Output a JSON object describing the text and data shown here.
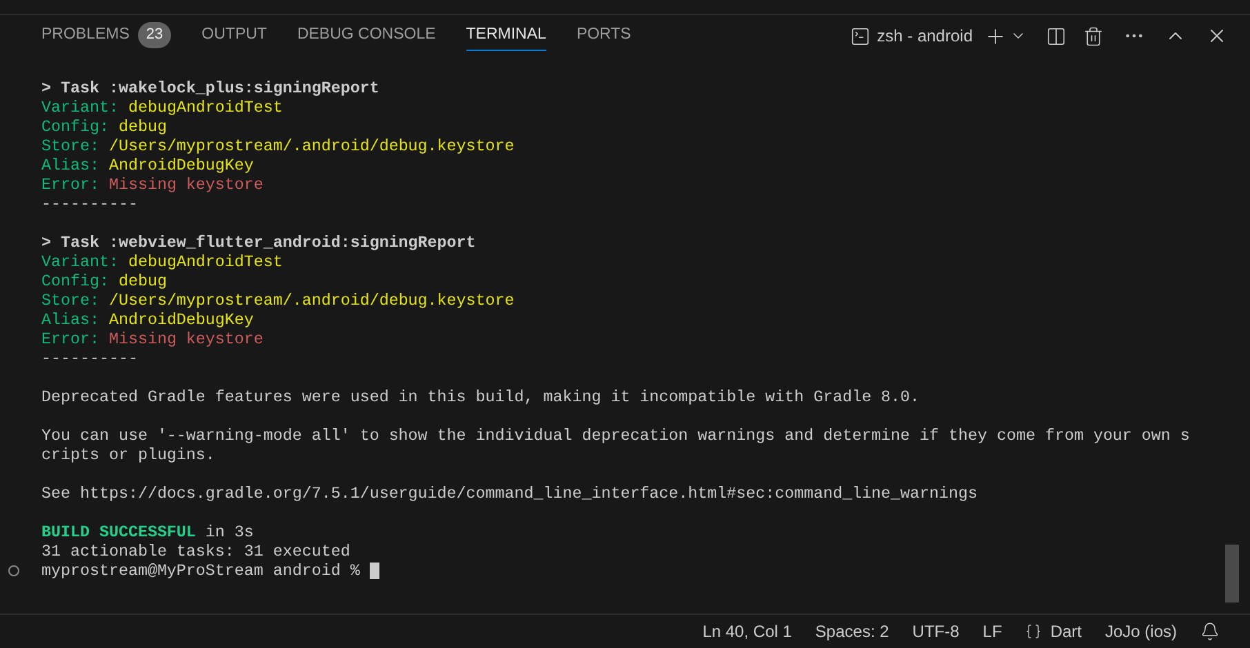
{
  "panel_tabs": [
    {
      "label": "PROBLEMS",
      "badge": "23",
      "selected": false
    },
    {
      "label": "OUTPUT",
      "selected": false
    },
    {
      "label": "DEBUG CONSOLE",
      "selected": false
    },
    {
      "label": "TERMINAL",
      "selected": true
    },
    {
      "label": "PORTS",
      "selected": false
    }
  ],
  "terminal_picker": {
    "label": "zsh - android"
  },
  "terminal_lines": [
    {
      "kind": "text",
      "segments": [
        {
          "text": "> Task :wakelock_plus:signingReport",
          "kind": "task"
        }
      ]
    },
    {
      "kind": "text",
      "segments": [
        {
          "text": "Variant: ",
          "kind": "key"
        },
        {
          "text": "debugAndroidTest",
          "kind": "value"
        }
      ]
    },
    {
      "kind": "text",
      "segments": [
        {
          "text": "Config: ",
          "kind": "key"
        },
        {
          "text": "debug",
          "kind": "value"
        }
      ]
    },
    {
      "kind": "text",
      "segments": [
        {
          "text": "Store: ",
          "kind": "key"
        },
        {
          "text": "/Users/myprostream/.android/debug.keystore",
          "kind": "value"
        }
      ]
    },
    {
      "kind": "text",
      "segments": [
        {
          "text": "Alias: ",
          "kind": "key"
        },
        {
          "text": "AndroidDebugKey",
          "kind": "value"
        }
      ]
    },
    {
      "kind": "text",
      "segments": [
        {
          "text": "Error: ",
          "kind": "key"
        },
        {
          "text": "Missing keystore",
          "kind": "error"
        }
      ]
    },
    {
      "kind": "text",
      "segments": [
        {
          "text": "----------",
          "kind": "plain"
        }
      ]
    },
    {
      "kind": "blank"
    },
    {
      "kind": "text",
      "segments": [
        {
          "text": "> Task :webview_flutter_android:signingReport",
          "kind": "task"
        }
      ]
    },
    {
      "kind": "text",
      "segments": [
        {
          "text": "Variant: ",
          "kind": "key"
        },
        {
          "text": "debugAndroidTest",
          "kind": "value"
        }
      ]
    },
    {
      "kind": "text",
      "segments": [
        {
          "text": "Config: ",
          "kind": "key"
        },
        {
          "text": "debug",
          "kind": "value"
        }
      ]
    },
    {
      "kind": "text",
      "segments": [
        {
          "text": "Store: ",
          "kind": "key"
        },
        {
          "text": "/Users/myprostream/.android/debug.keystore",
          "kind": "value"
        }
      ]
    },
    {
      "kind": "text",
      "segments": [
        {
          "text": "Alias: ",
          "kind": "key"
        },
        {
          "text": "AndroidDebugKey",
          "kind": "value"
        }
      ]
    },
    {
      "kind": "text",
      "segments": [
        {
          "text": "Error: ",
          "kind": "key"
        },
        {
          "text": "Missing keystore",
          "kind": "error"
        }
      ]
    },
    {
      "kind": "text",
      "segments": [
        {
          "text": "----------",
          "kind": "plain"
        }
      ]
    },
    {
      "kind": "blank"
    },
    {
      "kind": "text",
      "segments": [
        {
          "text": "Deprecated Gradle features were used in this build, making it incompatible with Gradle 8.0.",
          "kind": "plain"
        }
      ]
    },
    {
      "kind": "blank"
    },
    {
      "kind": "text",
      "segments": [
        {
          "text": "You can use '--warning-mode all' to show the individual deprecation warnings and determine if they come from your own s",
          "kind": "plain"
        }
      ]
    },
    {
      "kind": "text",
      "segments": [
        {
          "text": "cripts or plugins.",
          "kind": "plain"
        }
      ]
    },
    {
      "kind": "blank"
    },
    {
      "kind": "text",
      "segments": [
        {
          "text": "See https://docs.gradle.org/7.5.1/userguide/command_line_interface.html#sec:command_line_warnings",
          "kind": "plain"
        }
      ]
    },
    {
      "kind": "blank"
    },
    {
      "kind": "text",
      "segments": [
        {
          "text": "BUILD SUCCESSFUL",
          "kind": "success"
        },
        {
          "text": " in 3s",
          "kind": "plain"
        }
      ]
    },
    {
      "kind": "text",
      "segments": [
        {
          "text": "31 actionable tasks: 31 executed",
          "kind": "plain"
        }
      ]
    },
    {
      "kind": "prompt",
      "segments": [
        {
          "text": "myprostream@MyProStream android %",
          "kind": "plain"
        }
      ]
    }
  ],
  "status_bar": [
    "Ln 40, Col 1",
    "Spaces: 2",
    "UTF-8",
    "LF",
    "Dart",
    "JoJo (ios)"
  ]
}
